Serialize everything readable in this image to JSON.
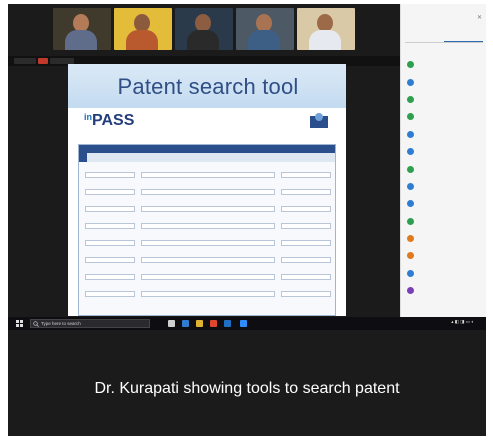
{
  "video_strip": {
    "tiles": [
      {
        "name": "",
        "bg": "#3f3a2c",
        "skin": "#b37b58",
        "shirt": "#5f6d8a"
      },
      {
        "name": "",
        "bg": "#e3bc3a",
        "skin": "#8c5a3c",
        "shirt": "#b85a2e"
      },
      {
        "name": "",
        "bg": "#2a3a4a",
        "skin": "#8c5d40",
        "shirt": "#2a2a2a"
      },
      {
        "name": "",
        "bg": "#4d5a66",
        "skin": "#a87353",
        "shirt": "#3d5f86"
      },
      {
        "name": "",
        "bg": "#d9c9a6",
        "skin": "#9c6a48",
        "shirt": "#e6eaf0"
      }
    ]
  },
  "meet_bar": {
    "recording_color": "#c0392b"
  },
  "shared_screen": {
    "title": "Patent search tool",
    "logo_text": "PASS",
    "logo_prefix": "in",
    "search_panel": {
      "heading": "",
      "tabs": [
        "",
        "",
        "",
        ""
      ]
    }
  },
  "participants_panel": {
    "title": "",
    "tabs": [
      "",
      ""
    ],
    "items": [
      {
        "name": "",
        "avatar_color": "#2e9e4f"
      },
      {
        "name": "",
        "avatar_color": "#2e7dd1"
      },
      {
        "name": "",
        "avatar_color": "#2e9e4f"
      },
      {
        "name": "",
        "avatar_color": "#2e9e4f"
      },
      {
        "name": "",
        "avatar_color": "#2e7dd1"
      },
      {
        "name": "",
        "avatar_color": "#2e7dd1"
      },
      {
        "name": "",
        "avatar_color": "#2e9e4f"
      },
      {
        "name": "",
        "avatar_color": "#2e7dd1"
      },
      {
        "name": "",
        "avatar_color": "#2e7dd1"
      },
      {
        "name": "",
        "avatar_color": "#2e9e4f"
      },
      {
        "name": "",
        "avatar_color": "#e07a1f"
      },
      {
        "name": "",
        "avatar_color": "#e07a1f"
      },
      {
        "name": "",
        "avatar_color": "#2e7dd1"
      },
      {
        "name": "",
        "avatar_color": "#7a3fb5"
      }
    ]
  },
  "taskbar": {
    "search_placeholder": "Type here to search",
    "icons": [
      {
        "name": "taskview-icon",
        "color": "#cfcfcf"
      },
      {
        "name": "edge-icon",
        "color": "#2e7dd1"
      },
      {
        "name": "file-explorer-icon",
        "color": "#e0b030"
      },
      {
        "name": "chrome-icon",
        "color": "#e0452f"
      },
      {
        "name": "outlook-icon",
        "color": "#1f6fc4"
      },
      {
        "name": "zoom-icon",
        "color": "#2d8cff"
      }
    ]
  },
  "caption": "Dr. Kurapati showing tools to search patent"
}
